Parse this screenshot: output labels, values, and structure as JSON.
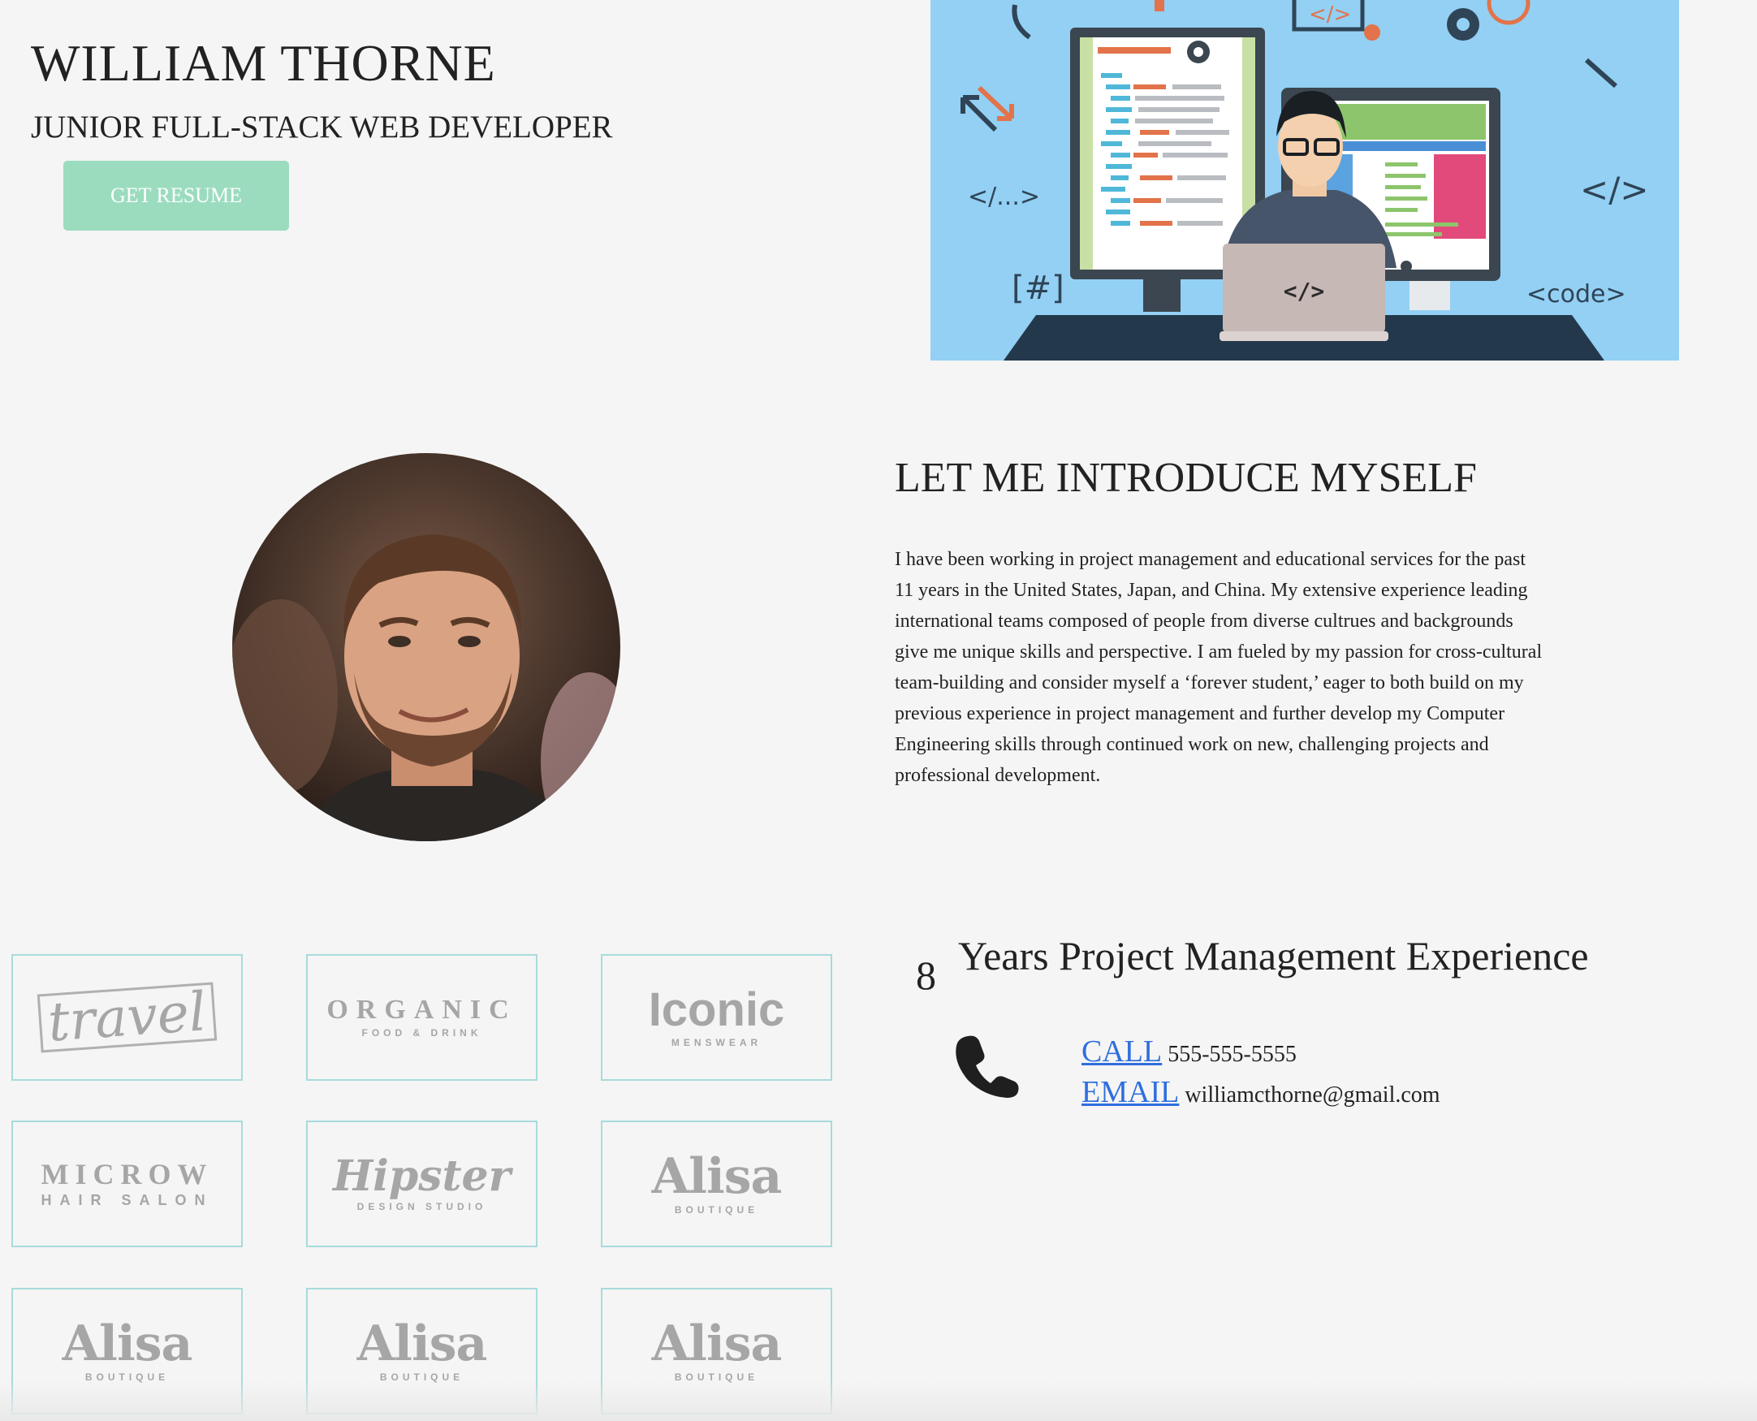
{
  "hero": {
    "name": "WILLIAM THORNE",
    "role": "JUNIOR FULL-STACK WEB DEVELOPER",
    "resume_label": "GET RESUME",
    "art_labels": {
      "tag_a": "</...>",
      "tag_b": "</>",
      "hash": "[#]",
      "code": "<code>",
      "laptop": "</>",
      "small_tag": "</>"
    }
  },
  "intro": {
    "title": "LET ME INTRODUCE MYSELF",
    "paragraph": "I have been working in project management and educational services for the past 11 years in the United States, Japan, and China. My extensive experience leading international teams composed of people from diverse cultrues and backgrounds give me unique skills and perspective. I am fueled by my passion for cross-cultural team-building and consider myself a ‘forever student,’ eager to both build on my previous experience in project management and further develop my Computer Engineering skills through continued work on new, challenging projects and professional development."
  },
  "logos": [
    {
      "name": "travel",
      "text": "travel",
      "sub": ""
    },
    {
      "name": "organic",
      "text": "ORGANIC",
      "sub": "FOOD & DRINK"
    },
    {
      "name": "iconic",
      "text": "Iconic",
      "sub": "MENSWEAR"
    },
    {
      "name": "microw",
      "text": "MICROW",
      "sub": "HAIR SALON"
    },
    {
      "name": "hipster",
      "text": "Hipster",
      "sub": "DESIGN STUDIO"
    },
    {
      "name": "alisa",
      "text": "Alisa",
      "sub": "BOUTIQUE"
    },
    {
      "name": "alisa",
      "text": "Alisa",
      "sub": "BOUTIQUE"
    },
    {
      "name": "alisa",
      "text": "Alisa",
      "sub": "BOUTIQUE"
    },
    {
      "name": "alisa",
      "text": "Alisa",
      "sub": "BOUTIQUE"
    }
  ],
  "stats": {
    "number": "8",
    "label": "Years Project Management Experience"
  },
  "contact": {
    "call_label": "CALL",
    "phone": "555-555-5555",
    "email_label": "EMAIL",
    "email": "williamcthorne@gmail.com"
  },
  "colors": {
    "resume_button": "#9bdcbf",
    "logo_border": "#a8dadb",
    "link": "#2f6fde",
    "hero_bg": "#93d0f4"
  },
  "icons": {
    "phone": "phone-icon"
  }
}
